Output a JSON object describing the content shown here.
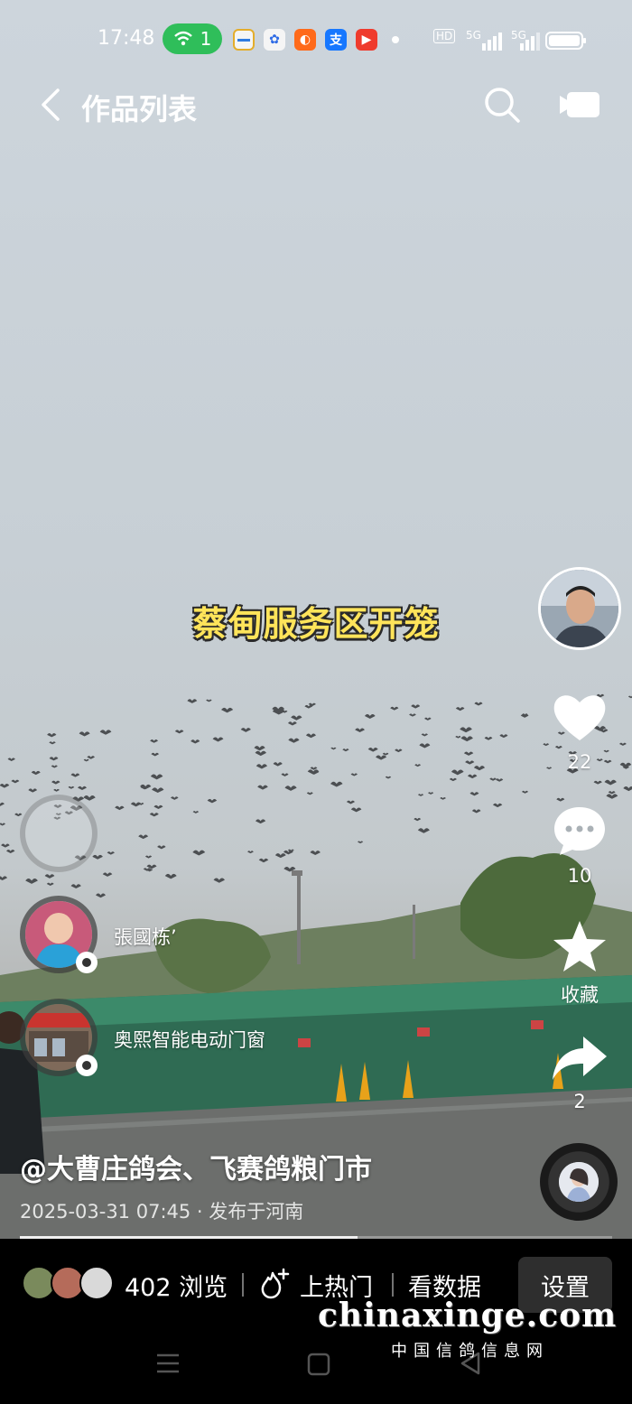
{
  "status_bar": {
    "time": "17:48",
    "wifi_count": "1",
    "network_labels": [
      "HD",
      "5G",
      "5G"
    ]
  },
  "nav": {
    "back_icon": "chevron-left-icon",
    "title": "作品列表",
    "search_icon": "search-icon",
    "camera_icon": "video-camera-icon"
  },
  "overlay": {
    "caption": "蔡甸服务区开笼",
    "caption_color": "#ffe45a"
  },
  "actions": {
    "likes": "22",
    "comments": "10",
    "favorite_label": "收藏",
    "shares": "2"
  },
  "visitors": [
    {
      "name": "張國栋’"
    },
    {
      "name": "奥熙智能电动门窗"
    }
  ],
  "video": {
    "title": "@大曹庄鸽会、飞赛鸽粮门市",
    "meta": "2025-03-31 07:45 · 发布于河南",
    "progress": 0.57
  },
  "bottom_bar": {
    "views": "402 浏览",
    "hot_label": "上热门",
    "data_label": "看数据",
    "settings_label": "设置"
  },
  "watermark": {
    "main": "chinaxinge.com",
    "sub": "中国信鸽信息网"
  },
  "colors": {
    "wifi_pill": "#2fbe5a",
    "background": "#000000"
  }
}
